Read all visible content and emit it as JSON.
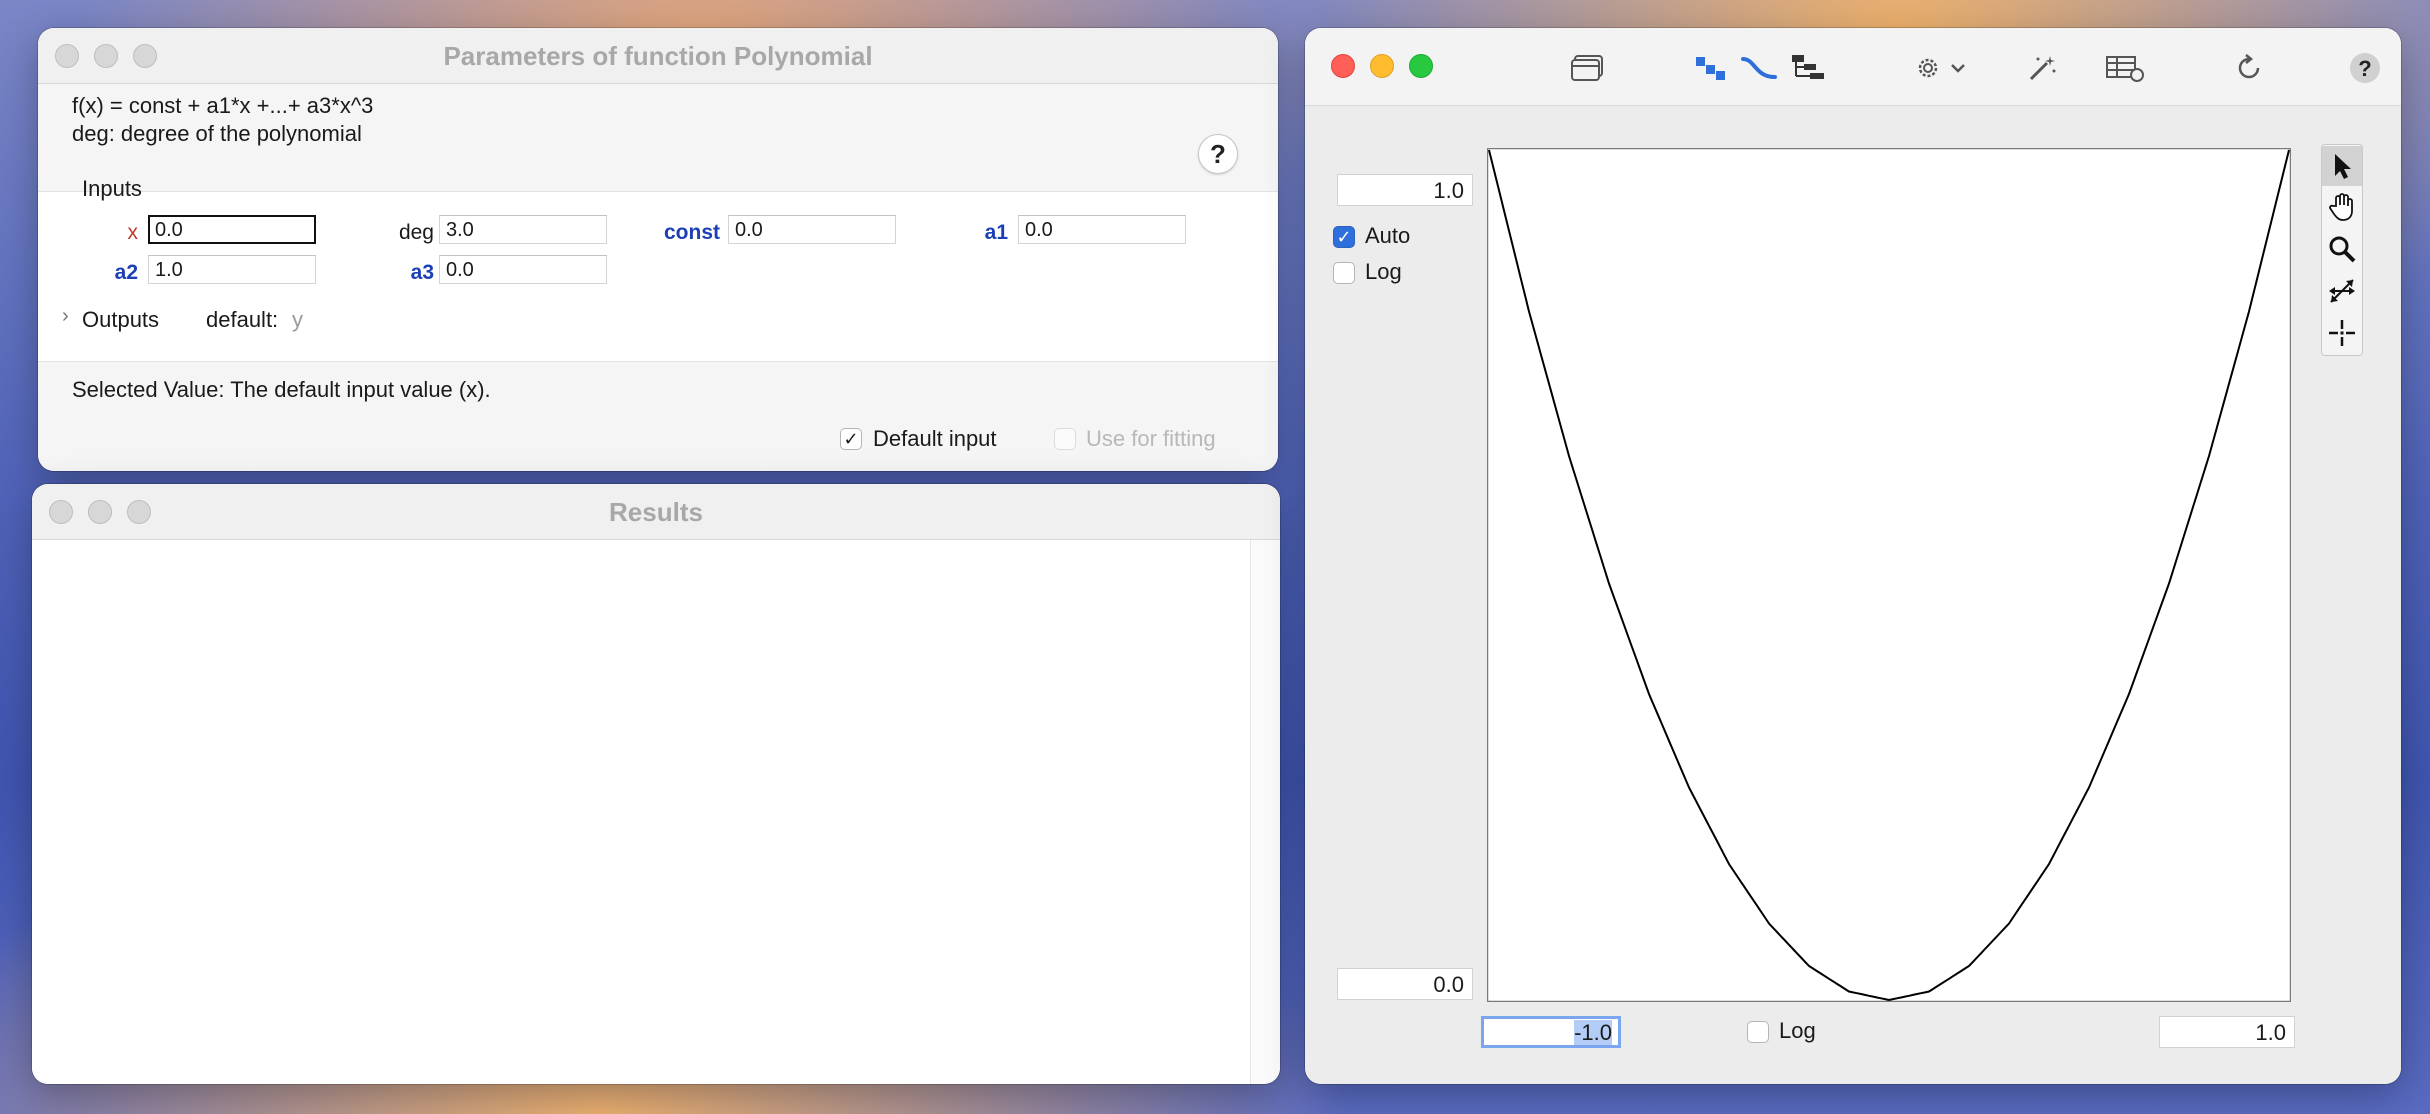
{
  "params_window": {
    "title": "Parameters of function Polynomial",
    "description_line1": "f(x) = const + a1*x +...+ a3*x^3",
    "description_line2": "deg: degree of the polynomial",
    "help_label": "?",
    "inputs_label": "Inputs",
    "params": [
      {
        "name": "x",
        "value": "0.0"
      },
      {
        "name": "deg",
        "value": "3.0"
      },
      {
        "name": "const",
        "value": "0.0"
      },
      {
        "name": "a1",
        "value": "0.0"
      },
      {
        "name": "a2",
        "value": "1.0"
      },
      {
        "name": "a3",
        "value": "0.0"
      }
    ],
    "outputs_label": "Outputs",
    "outputs_default_label": "default:",
    "outputs_default_value": "y",
    "selected_value_text": "Selected Value: The default input value (x).",
    "default_input_label": "Default input",
    "default_input_checked": true,
    "use_for_fitting_label": "Use for fitting",
    "use_for_fitting_enabled": false
  },
  "results_window": {
    "title": "Results"
  },
  "plot_window": {
    "toolbar_icons": [
      "window-icon",
      "points-icon",
      "curve-icon",
      "tree-icon",
      "gear-icon",
      "magic-wand-icon",
      "table-icon",
      "refresh-icon",
      "help-icon"
    ],
    "y_max": "1.0",
    "y_min": "0.0",
    "y_auto_label": "Auto",
    "y_auto_checked": true,
    "y_log_label": "Log",
    "y_log_checked": false,
    "x_min": "-1.0",
    "x_max": "1.0",
    "x_log_label": "Log",
    "x_log_checked": false,
    "tools": [
      "arrow-pointer-icon",
      "hand-pan-icon",
      "magnifier-icon",
      "move-arrows-icon",
      "crosshair-icon"
    ],
    "active_tool": "arrow-pointer-icon",
    "accent_color": "#2f6fdc"
  },
  "chart_data": {
    "type": "line",
    "series": [
      {
        "x": [
          -1.0,
          -0.9,
          -0.8,
          -0.7,
          -0.6,
          -0.5,
          -0.4,
          -0.3,
          -0.2,
          -0.1,
          0.0,
          0.1,
          0.2,
          0.3,
          0.4,
          0.5,
          0.6,
          0.7,
          0.8,
          0.9,
          1.0
        ],
        "y": [
          1.0,
          0.81,
          0.64,
          0.49,
          0.36,
          0.25,
          0.16,
          0.09,
          0.04,
          0.01,
          0.0,
          0.01,
          0.04,
          0.09,
          0.16,
          0.25,
          0.36,
          0.49,
          0.64,
          0.81,
          1.0
        ],
        "color": "#000000"
      }
    ],
    "xlim": [
      -1.0,
      1.0
    ],
    "ylim": [
      0.0,
      1.0
    ],
    "grid": false,
    "xlabel": "",
    "ylabel": ""
  }
}
